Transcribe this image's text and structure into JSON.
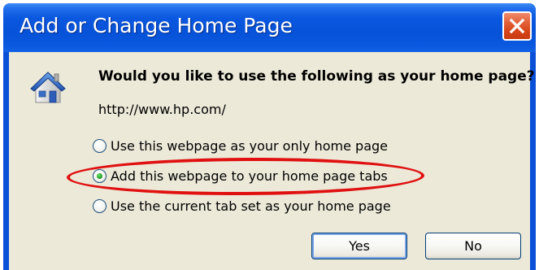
{
  "dialog": {
    "title": "Add or Change Home Page",
    "question": "Would you like to use the following as your home page?",
    "url": "http://www.hp.com/",
    "options": [
      {
        "label": "Use this webpage as your only home page",
        "selected": false
      },
      {
        "label": "Add this webpage to your home page tabs",
        "selected": true
      },
      {
        "label": "Use the current tab set as your home page",
        "selected": false
      }
    ],
    "buttons": {
      "yes": "Yes",
      "no": "No"
    }
  },
  "icons": {
    "close": "close-icon",
    "house": "house-icon"
  },
  "colors": {
    "titlebar": "#0652d8",
    "close_button": "#d64519",
    "client_background": "#ece9d8",
    "highlight": "#e01010",
    "radio_dot": "#21a121"
  }
}
